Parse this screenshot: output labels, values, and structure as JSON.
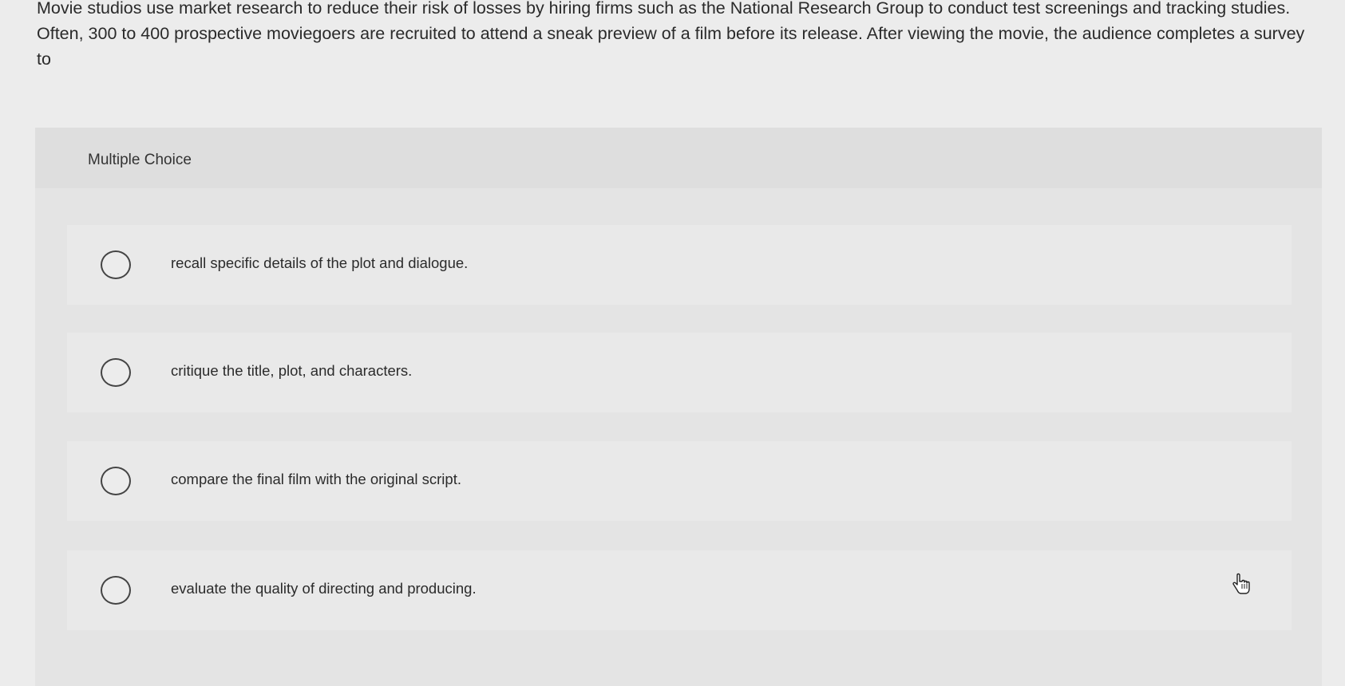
{
  "question": {
    "text": "Movie studios use market research to reduce their risk of losses by hiring firms such as the National Research Group to conduct test screenings and tracking studies. Often, 300 to 400 prospective moviegoers are recruited to attend a sneak preview of a film before its release. After viewing the movie, the audience completes a survey to"
  },
  "mc": {
    "label": "Multiple Choice",
    "options": [
      {
        "label": "recall specific details of the plot and dialogue."
      },
      {
        "label": "critique the title, plot, and characters."
      },
      {
        "label": "compare the final film with the original script."
      },
      {
        "label": "evaluate the quality of directing and producing."
      }
    ]
  },
  "icons": {
    "radio": "radio-button-unselected-icon",
    "cursor": "hand-pointer-cursor-icon"
  }
}
